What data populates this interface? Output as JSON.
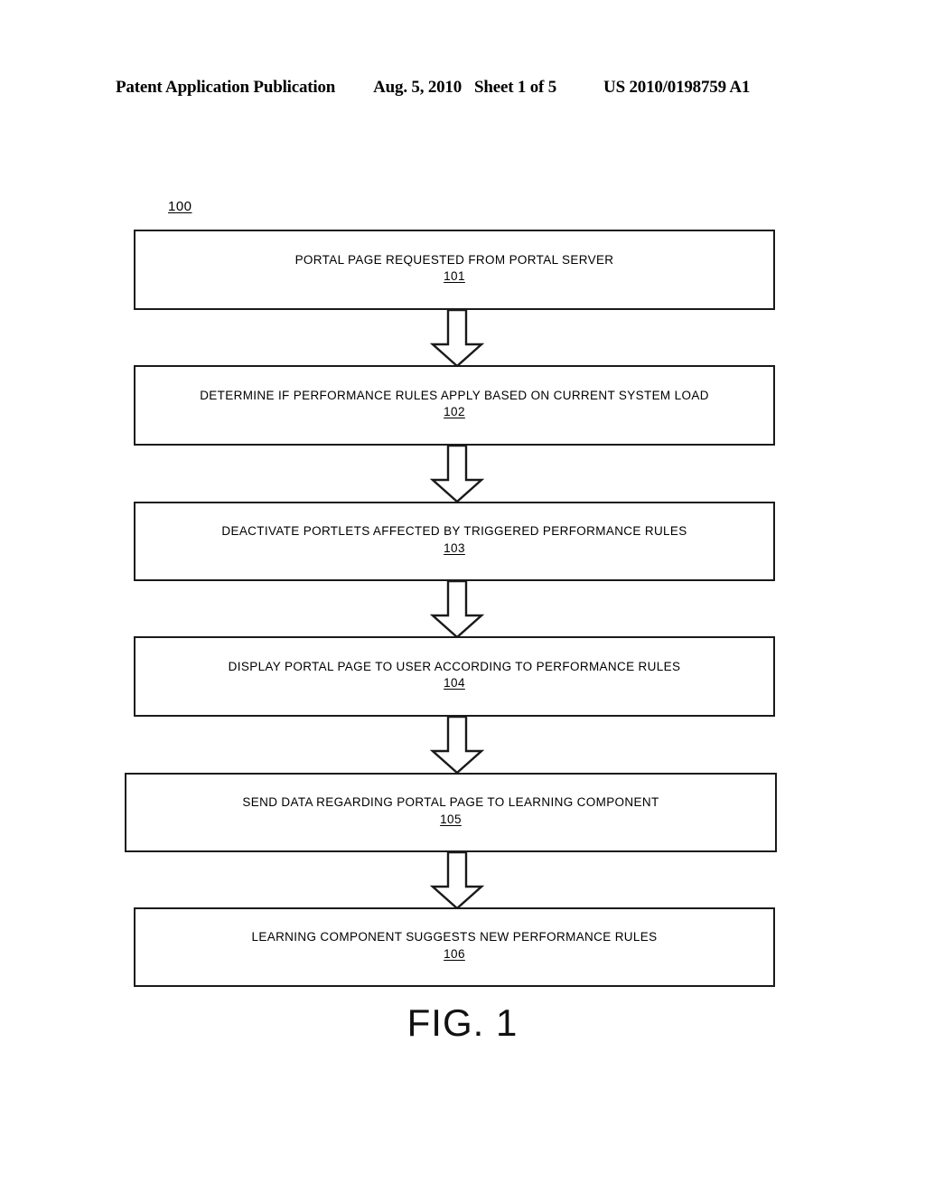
{
  "header": {
    "publication": "Patent Application Publication",
    "date": "Aug. 5, 2010",
    "sheet": "Sheet 1 of 5",
    "patent_number": "US 2010/0198759 A1"
  },
  "figure": {
    "reference_numeral": "100",
    "caption": "FIG. 1",
    "steps": [
      {
        "text": "PORTAL PAGE REQUESTED FROM PORTAL SERVER",
        "numeral": "101"
      },
      {
        "text": "DETERMINE IF PERFORMANCE RULES APPLY BASED ON CURRENT SYSTEM LOAD",
        "numeral": "102"
      },
      {
        "text": "DEACTIVATE PORTLETS AFFECTED BY TRIGGERED PERFORMANCE RULES",
        "numeral": "103"
      },
      {
        "text": "DISPLAY PORTAL PAGE TO USER ACCORDING TO PERFORMANCE RULES",
        "numeral": "104"
      },
      {
        "text": "SEND DATA REGARDING PORTAL PAGE TO LEARNING COMPONENT",
        "numeral": "105"
      },
      {
        "text": "LEARNING COMPONENT SUGGESTS NEW PERFORMANCE RULES",
        "numeral": "106"
      }
    ],
    "connectors": [
      {
        "from": "101",
        "to": "102",
        "type": "block-arrow-down"
      },
      {
        "from": "102",
        "to": "103",
        "type": "block-arrow-down"
      },
      {
        "from": "103",
        "to": "104",
        "type": "block-arrow-down"
      },
      {
        "from": "104",
        "to": "105",
        "type": "block-arrow-down"
      },
      {
        "from": "105",
        "to": "106",
        "type": "block-arrow-down"
      }
    ]
  },
  "colors": {
    "ink": "#1a1a1a",
    "paper": "#ffffff"
  }
}
